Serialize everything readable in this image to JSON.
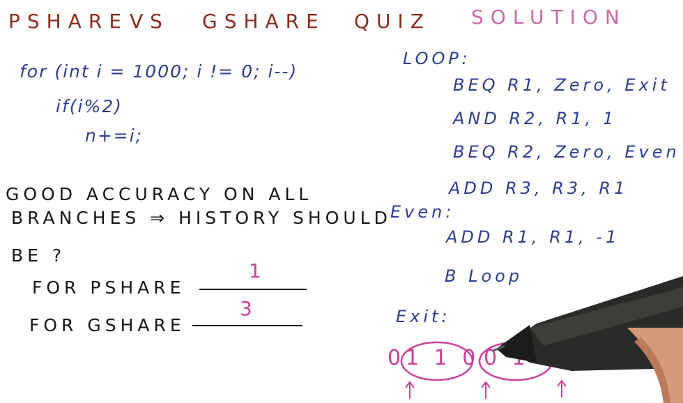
{
  "title": {
    "part1": "PSHARE",
    "part2": "VS",
    "part3": "GSHARE",
    "part4": "QUIZ",
    "part5": "SOLUTION"
  },
  "code": {
    "line1": "for (int i = 1000; i != 0; i--)",
    "line2": "if(i%2)",
    "line3": "n+=i;"
  },
  "question": {
    "line1": "GOOD ACCURACY ON ALL",
    "line2": "BRANCHES ⇒ HISTORY SHOULD",
    "line3": "BE ?",
    "pshare_label": "FOR PSHARE",
    "pshare_answer": "1",
    "gshare_label": "FOR GSHARE",
    "gshare_answer": "3"
  },
  "assembly": {
    "loop_label": "LOOP:",
    "instr1": "BEQ  R1, Zero, Exit",
    "instr2": "AND  R2, R1, 1",
    "instr3": "BEQ  R2, Zero, Even",
    "instr4": "ADD  R3, R3, R1",
    "even_label": "Even:",
    "instr5": "ADD  R1, R1, -1",
    "instr6": "B  Loop",
    "exit_label": "Exit:"
  },
  "history": {
    "lead": "0",
    "group1": "1 1 0",
    "group2": "0 1",
    "tail": "0 1 1 0 0 1"
  },
  "colors": {
    "title_dark": "#8b2b1e",
    "title_pink": "#c86aa6",
    "code_blue": "#2b3d8f",
    "question_dark": "#151515",
    "answer_pink": "#c8439a"
  }
}
